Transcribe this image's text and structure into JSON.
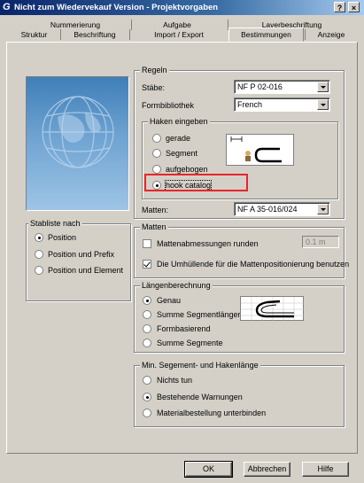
{
  "window": {
    "title": "Nicht zum Wiedervekauf Version - Projektvorgaben",
    "help_btn": "?",
    "close_btn": "×"
  },
  "tabs": {
    "row1": [
      "Nummerierung",
      "Aufgabe",
      "Laverbeschriftung"
    ],
    "row2": [
      "Struktur",
      "Beschriftung",
      "Import / Export",
      "Bestimmungen",
      "Anzeige"
    ],
    "active": "Bestimmungen"
  },
  "stabliste": {
    "title": "Stabliste nach",
    "options": [
      "Position",
      "Position und Prefix",
      "Position und Element"
    ],
    "selected": 0
  },
  "regeln": {
    "title": "Regeln",
    "staebe_label": "Stäbe:",
    "staebe_value": "NF P 02-016",
    "formbibliothek_label": "Formbibliothek",
    "formbibliothek_value": "French",
    "haken": {
      "title": "Haken eingeben",
      "options": [
        "gerade",
        "Segment",
        "aufgebogen",
        "hook catalog"
      ],
      "selected": 3
    },
    "matten_label": "Matten:",
    "matten_value": "NF A 35-016/024"
  },
  "matten": {
    "title": "Matten",
    "checks": [
      {
        "label": "Mattenabmessungen runden",
        "checked": false
      },
      {
        "label": "Die Umhüllende für die Mattenpositionierung benutzen",
        "checked": true
      }
    ],
    "round_value": "0.1 m"
  },
  "laengen": {
    "title": "Längenberechnung",
    "options": [
      "Genau",
      "Summe Segmentlänger",
      "Formbasierend",
      "Summe Segmente"
    ],
    "selected": 0
  },
  "minseg": {
    "title": "Min. Segement- und Hakenlänge",
    "options": [
      "Nichts tun",
      "Bestehende Warnungen",
      "Materialbestellung unterbinden"
    ],
    "selected": 1
  },
  "buttons": {
    "ok": "OK",
    "cancel": "Abbrechen",
    "help": "Hilfe"
  },
  "colors": {
    "highlight": "#e8262a",
    "titlebar": "#0a246a"
  }
}
